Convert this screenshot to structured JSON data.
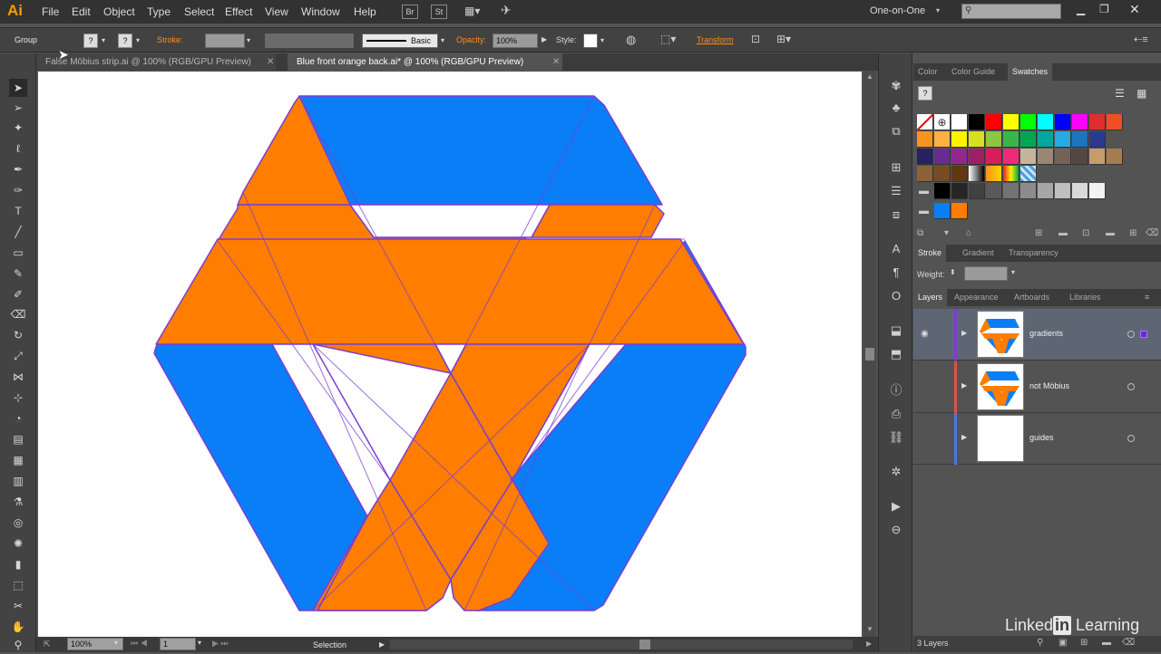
{
  "app": {
    "logo": "Ai",
    "workspace": "One-on-One"
  },
  "menu": [
    "File",
    "Edit",
    "Object",
    "Type",
    "Select",
    "Effect",
    "View",
    "Window",
    "Help"
  ],
  "menu_badges": [
    "Br",
    "St"
  ],
  "control": {
    "selection_type": "Group",
    "stroke_label": "Stroke:",
    "stroke_style": "Basic",
    "opacity_label": "Opacity:",
    "opacity_value": "100%",
    "style_label": "Style:",
    "transform_label": "Transform"
  },
  "tabs": [
    {
      "label": "False Möbius strip.ai @ 100% (RGB/GPU Preview)"
    },
    {
      "label": "Blue front orange back.ai* @ 100% (RGB/GPU Preview)"
    }
  ],
  "status": {
    "zoom": "100%",
    "page": "1",
    "tool": "Selection"
  },
  "panels": {
    "color_tabs": [
      "Color",
      "Color Guide",
      "Swatches"
    ],
    "stroke_tabs": [
      "Stroke",
      "Gradient",
      "Transparency"
    ],
    "weight_label": "Weight:",
    "layer_tabs": [
      "Layers",
      "Appearance",
      "Artboards",
      "Libraries"
    ],
    "layers": [
      {
        "name": "gradients",
        "color": "#7a3fd0"
      },
      {
        "name": "not Möbius",
        "color": "#e0504a"
      },
      {
        "name": "guides",
        "color": "#4a78e0"
      }
    ],
    "layer_count": "3 Layers"
  },
  "swatch_colors": {
    "row1": [
      "#ffffff",
      "#000000",
      "#ff0000",
      "#ffff00",
      "#00ff00",
      "#00ffff",
      "#0000ff",
      "#ff00ff",
      "#e02d2d",
      "#f04e23"
    ],
    "row2": [
      "#f7941d",
      "#fbb040",
      "#fff200",
      "#d7df23",
      "#8dc63f",
      "#39b54a",
      "#00a651",
      "#00a79d",
      "#27aae1",
      "#1c75bc",
      "#2b3990"
    ],
    "row3": [
      "#262262",
      "#662d91",
      "#92278f",
      "#9e1f63",
      "#da1c5c",
      "#ee2a7b",
      "#c2b59b",
      "#998675",
      "#736357",
      "#534741",
      "#c69c6d",
      "#a67c52"
    ],
    "row4": [
      "#8c6239",
      "#754c24",
      "#603813",
      "#42210b"
    ],
    "grays": [
      "#000000",
      "#262626",
      "#404040",
      "#595959",
      "#737373",
      "#8c8c8c",
      "#a6a6a6",
      "#bfbfbf",
      "#d9d9d9",
      "#f2f2f2"
    ]
  },
  "artwork_colors": {
    "blue": "#0a7ef7",
    "orange": "#ff7d00",
    "path": "#7a3fd0"
  },
  "watermark": {
    "linked": "Linked",
    "in": "in",
    "learning": " Learning"
  }
}
